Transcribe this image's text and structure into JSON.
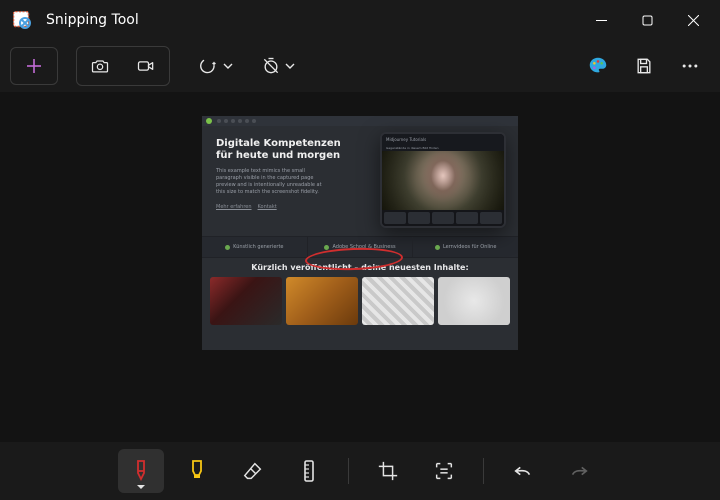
{
  "window": {
    "title": "Snipping Tool"
  },
  "toolbar": {
    "new_label": "New",
    "mode_photo": "Photo mode",
    "mode_video": "Video mode",
    "shape": "Snip shape",
    "delay": "Delay",
    "paint": "Edit in Paint",
    "save": "Save",
    "more": "More"
  },
  "screenshot": {
    "hero_title_line1": "Digitale Kompetenzen",
    "hero_title_line2": "für heute und morgen",
    "hero_body": "This example text mimics the small paragraph visible in the captured page preview and is intentionally unreadable at this size to match the screenshot fidelity.",
    "hero_link1": "Mehr erfahren",
    "hero_link2": "Kontakt",
    "tablet_caption1": "Midjourney Tutorials",
    "tablet_caption2": "Gegenstände in diesem Bild finden",
    "strip1": "Künstlich generierte",
    "strip2": "Adobe School & Business",
    "strip3": "Lernvideos für Online",
    "subhead": "Kürzlich veröffentlicht – deine neuesten Inhalte:"
  },
  "bottombar": {
    "pen": "Ballpoint pen",
    "highlighter": "Highlighter",
    "eraser": "Eraser",
    "ruler": "Ruler",
    "crop": "Crop",
    "text_extract": "Text actions",
    "undo": "Undo",
    "redo": "Redo"
  },
  "colors": {
    "accent": "#c36cd6",
    "pen": "#d02e2e",
    "highlighter": "#f6c514"
  }
}
